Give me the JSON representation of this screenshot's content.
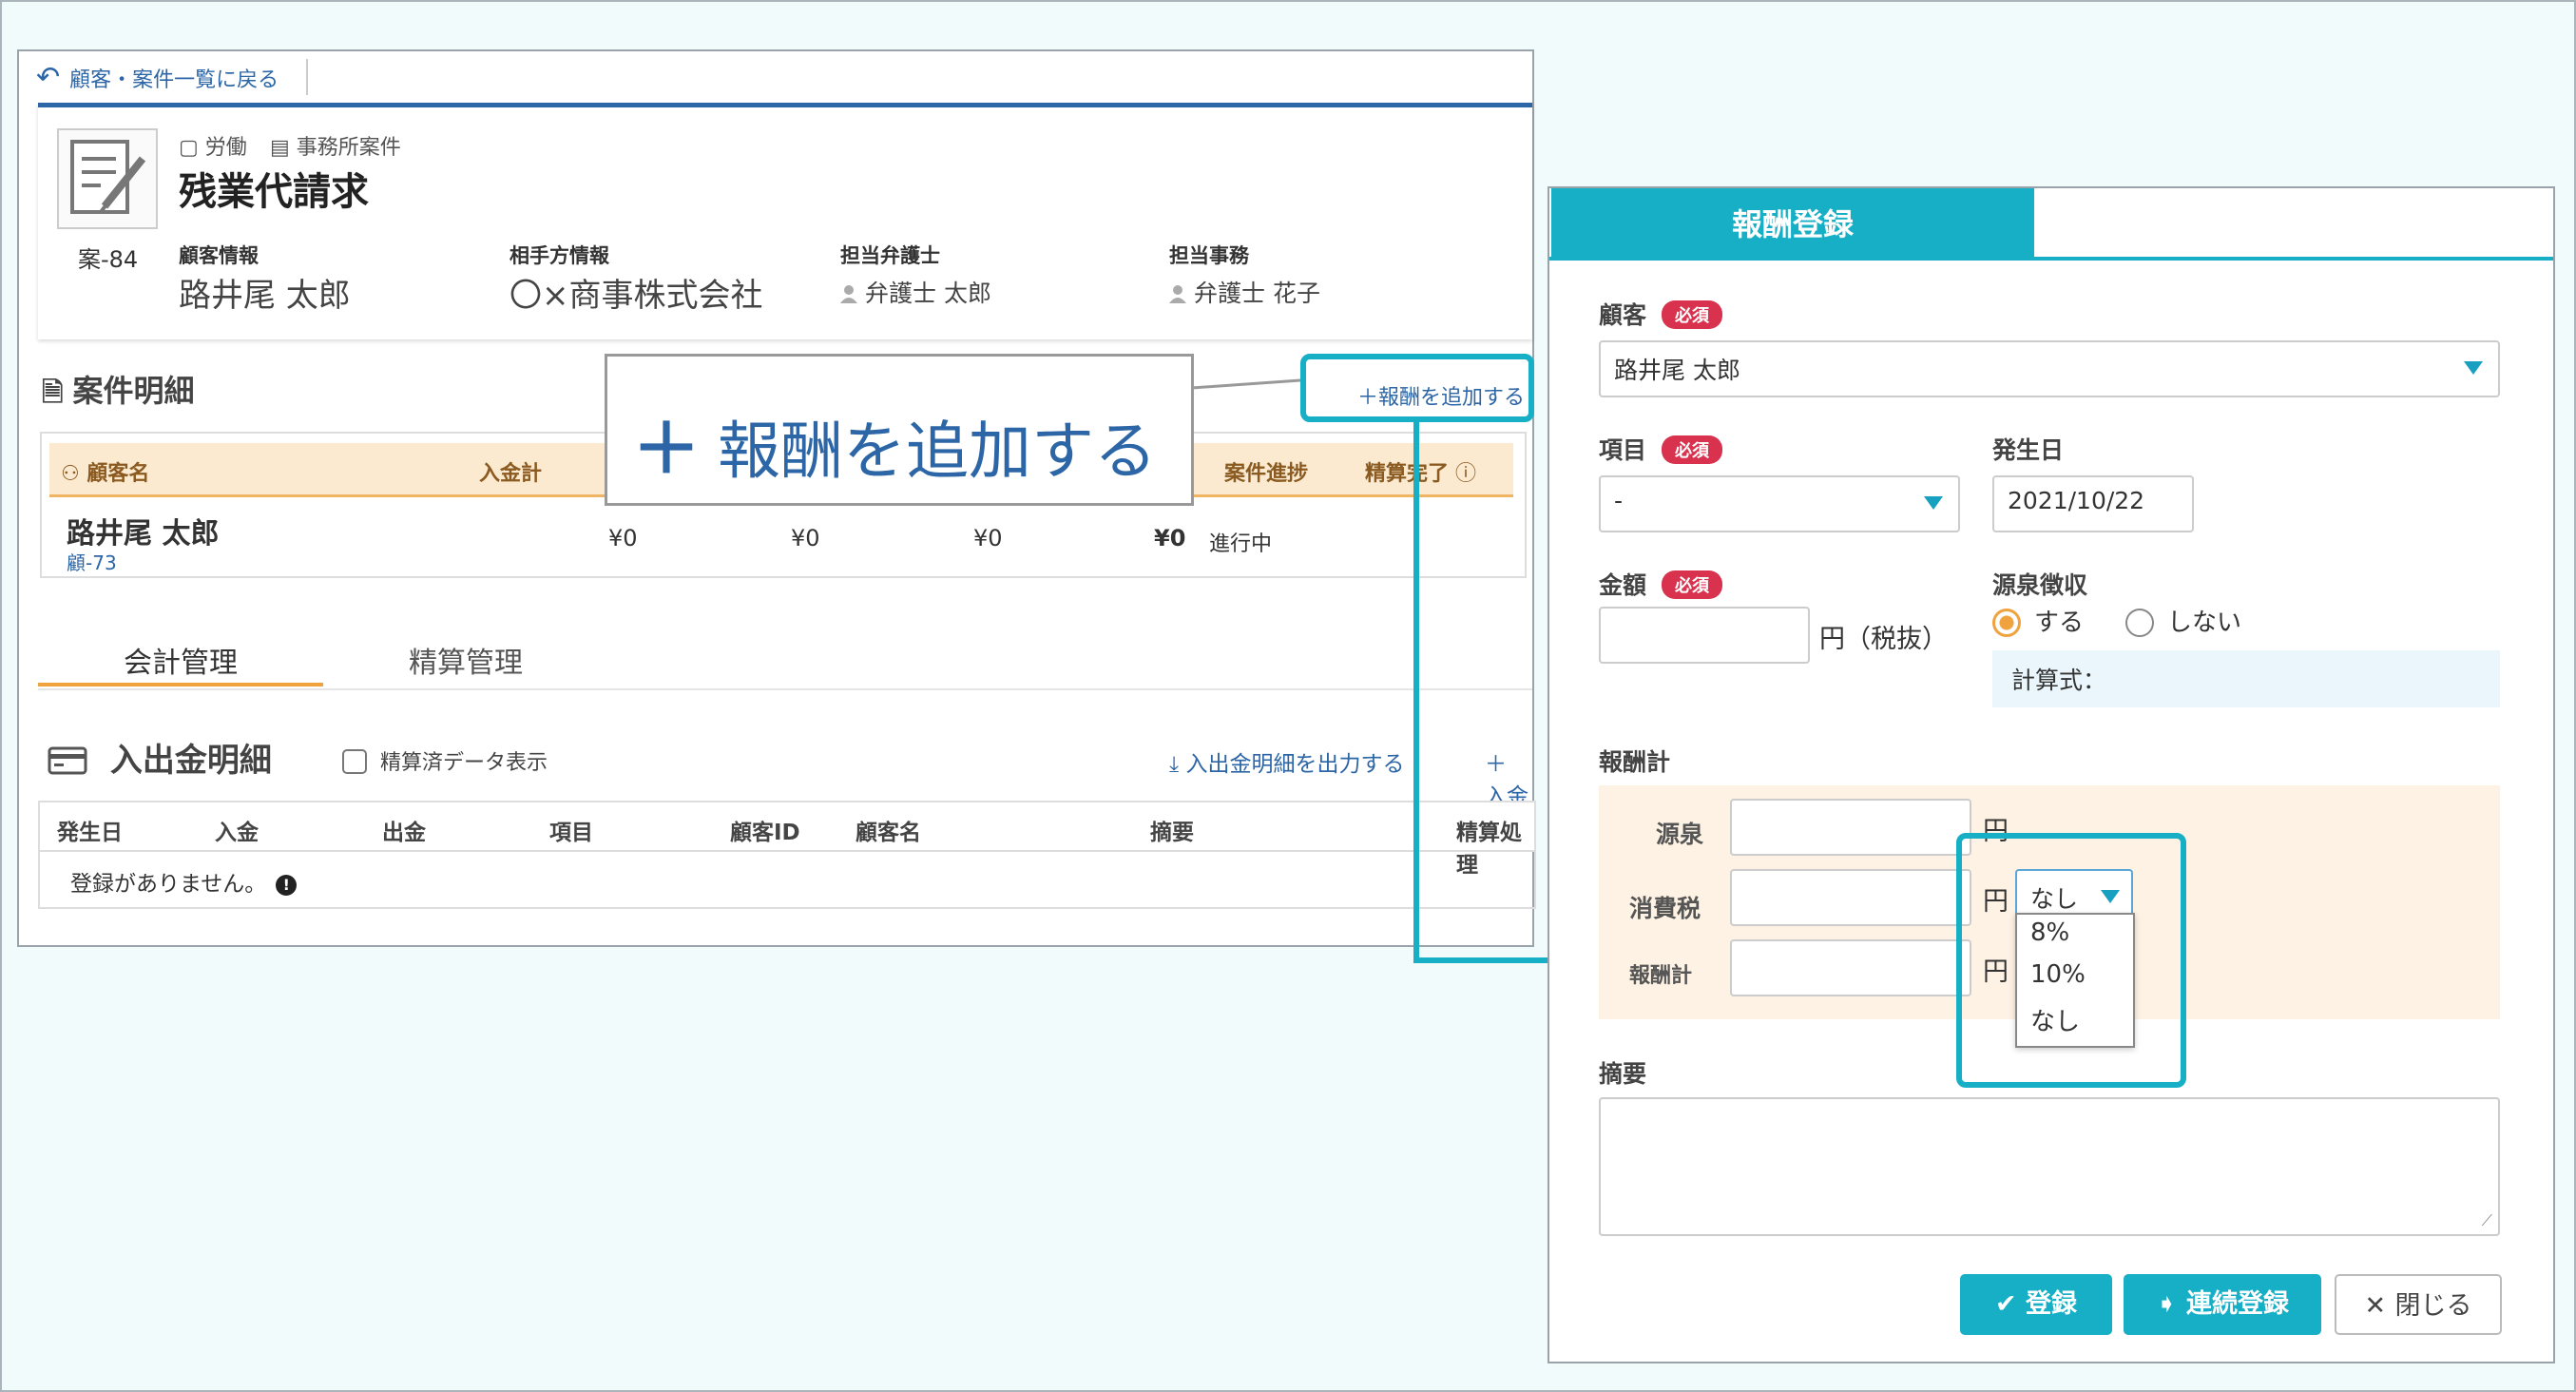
{
  "back_link": "顧客・案件一覧に戻る",
  "case": {
    "tags": [
      "労働",
      "事務所案件"
    ],
    "title": "残業代請求",
    "number": "案-84",
    "client_label": "顧客情報",
    "client_value": "路井尾 太郎",
    "opponent_label": "相手方情報",
    "opponent_value": "〇×商事株式会社",
    "lawyer_label": "担当弁護士",
    "lawyer_value": "弁護士 太郎",
    "staff_label": "担当事務",
    "staff_value": "弁護士 花子"
  },
  "detail": {
    "title": "案件明細",
    "add_fee_link": "報酬を追加する",
    "columns": [
      "顧客名",
      "入金計",
      "案件進捗",
      "精算完了"
    ],
    "row": {
      "client_name": "路井尾 太郎",
      "client_id": "顧-73",
      "values": [
        "¥0",
        "¥0",
        "¥0",
        "¥0"
      ],
      "progress": "進行中"
    }
  },
  "tabs": [
    "会計管理",
    "精算管理"
  ],
  "io": {
    "title": "入出金明細",
    "settled_toggle": "精算済データ表示",
    "export_link": "入出金明細を出力する",
    "add_link": "入金",
    "columns": [
      "発生日",
      "入金",
      "出金",
      "項目",
      "顧客ID",
      "顧客名",
      "摘要",
      "精算処理"
    ],
    "empty_message": "登録がありません。"
  },
  "callout": {
    "text": "報酬を追加する"
  },
  "modal": {
    "title": "報酬登録",
    "required_badge": "必須",
    "client_label": "顧客",
    "client_value": "路井尾 太郎",
    "item_label": "項目",
    "item_value": "-",
    "date_label": "発生日",
    "date_value": "2021/10/22",
    "amount_label": "金額",
    "amount_unit": "円（税抜）",
    "withholding_label": "源泉徴収",
    "withholding_options": [
      "する",
      "しない"
    ],
    "withholding_selected": "する",
    "formula_label": "計算式：",
    "total_section_label": "報酬計",
    "withholding_row_label": "源泉",
    "tax_row_label": "消費税",
    "total_row_label": "報酬計",
    "yen": "円",
    "tax_select_value": "なし",
    "tax_options": [
      "8%",
      "10%",
      "なし"
    ],
    "memo_label": "摘要",
    "register_button": "登録",
    "continuous_button": "連続登録",
    "close_button": "閉じる"
  },
  "colors": {
    "accent": "#17afc6",
    "link": "#2d66a6",
    "required": "#d9324e",
    "tab_active": "#f0a23e"
  }
}
